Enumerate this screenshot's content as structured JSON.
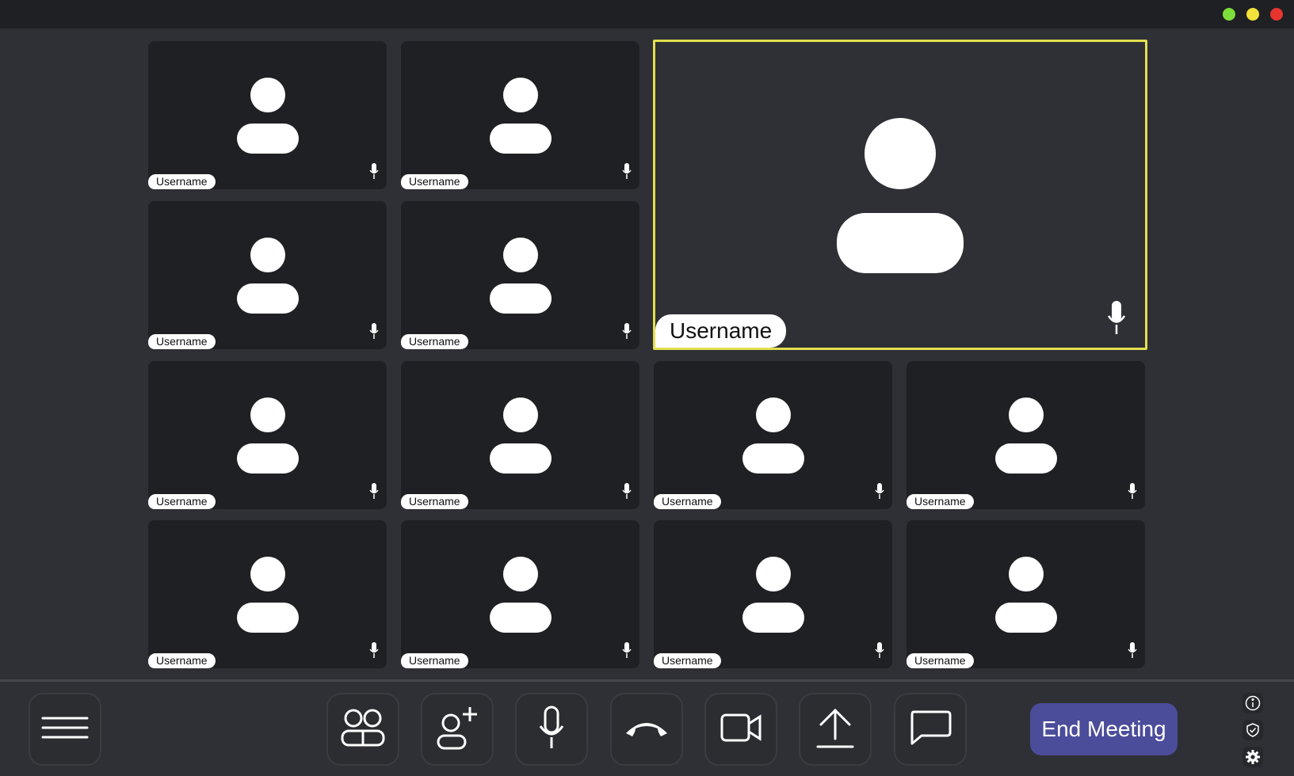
{
  "window": {
    "controls": [
      {
        "name": "maximize",
        "color": "#7ddf3b"
      },
      {
        "name": "minimize",
        "color": "#f2e23a"
      },
      {
        "name": "close",
        "color": "#e8342f"
      }
    ]
  },
  "participants": [
    {
      "name": "Username",
      "muted": false
    },
    {
      "name": "Username",
      "muted": false
    },
    {
      "name": "Username",
      "muted": false,
      "active_speaker": true
    },
    {
      "name": "Username",
      "muted": false
    },
    {
      "name": "Username",
      "muted": false
    },
    {
      "name": "Username",
      "muted": false
    },
    {
      "name": "Username",
      "muted": false
    },
    {
      "name": "Username",
      "muted": false
    },
    {
      "name": "Username",
      "muted": false
    },
    {
      "name": "Username",
      "muted": false
    },
    {
      "name": "Username",
      "muted": false
    },
    {
      "name": "Username",
      "muted": false
    },
    {
      "name": "Username",
      "muted": false
    }
  ],
  "toolbar": {
    "buttons": [
      {
        "icon": "menu-icon"
      },
      {
        "icon": "participants-icon"
      },
      {
        "icon": "add-user-icon"
      },
      {
        "icon": "microphone-icon"
      },
      {
        "icon": "hang-up-icon"
      },
      {
        "icon": "video-camera-icon"
      },
      {
        "icon": "share-screen-icon"
      },
      {
        "icon": "chat-icon"
      }
    ],
    "end_meeting_label": "End Meeting",
    "side_icons": [
      "info-icon",
      "security-shield-icon",
      "settings-gear-icon"
    ]
  },
  "colors": {
    "active_speaker_border": "#e3df4f",
    "end_meeting_button": "#4b4c9a",
    "tile_background": "#1f2023",
    "app_background": "#2e3035"
  }
}
